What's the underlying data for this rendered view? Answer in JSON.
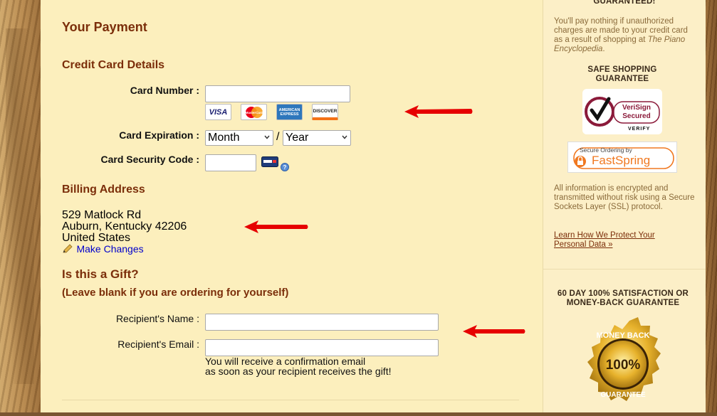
{
  "page": {
    "title": "Your Payment"
  },
  "credit_card": {
    "heading": "Credit Card Details",
    "card_number_label": "Card Number :",
    "card_number_value": "",
    "card_brands": [
      {
        "name": "VISA",
        "color": "#1a1f71"
      },
      {
        "name": "MasterCard",
        "color": "#eb001b"
      },
      {
        "name": "AMERICAN EXPRESS",
        "color": "#2e77bc"
      },
      {
        "name": "DISCOVER",
        "color": "#f47216"
      }
    ],
    "expiration_label": "Card Expiration :",
    "month_selected": "Month",
    "separator": "/",
    "year_selected": "Year",
    "security_code_label": "Card Security Code :",
    "security_code_value": "",
    "help_icon": "question-icon"
  },
  "billing": {
    "heading": "Billing Address",
    "line1": "529 Matlock Rd",
    "line2": "Auburn, Kentucky 42206",
    "line3": "United States",
    "edit_link": "Make Changes"
  },
  "gift": {
    "heading": "Is this a Gift?",
    "subheading": "(Leave blank if you are ordering for yourself)",
    "recipient_name_label": "Recipient's Name :",
    "recipient_name_value": "",
    "recipient_email_label": "Recipient's Email :",
    "recipient_email_value": "",
    "note_line1": "You will receive a confirmation email",
    "note_line2": "as soon as your recipient receives the gift!"
  },
  "sidebar": {
    "guarantee_head_partial": "GUARANTEED!",
    "guarantee_text_prefix": "You'll pay nothing if unauthorized charges are made to your credit card as a result of shopping at ",
    "guarantee_text_em": "The Piano Encyclopedia",
    "guarantee_text_suffix": ".",
    "safe_heading_line1": "SAFE SHOPPING",
    "safe_heading_line2": "GUARANTEE",
    "verisign_line1": "VeriSign",
    "verisign_line2": "Secured",
    "verisign_verify": "VERIFY",
    "fastspring_top": "Secure Ordering by",
    "fastspring_name": "FastSpring",
    "ssl_text": "All information is encrypted and transmitted without risk using a Secure Sockets Layer (SSL) protocol.",
    "protect_link": "Learn How We Protect Your Personal Data »",
    "satisfaction_line1": "60 DAY 100% SATISFACTION OR",
    "satisfaction_line2": "MONEY-BACK GUARANTEE",
    "seal_top": "MONEY BACK",
    "seal_mid": "100%",
    "seal_bottom": "GUARANTEE"
  },
  "colors": {
    "heading": "#7b2e0a",
    "main_bg": "#fcefbd",
    "sidebar_bg": "#fcefc7",
    "arrow": "#e60000",
    "link": "#0000cc"
  }
}
